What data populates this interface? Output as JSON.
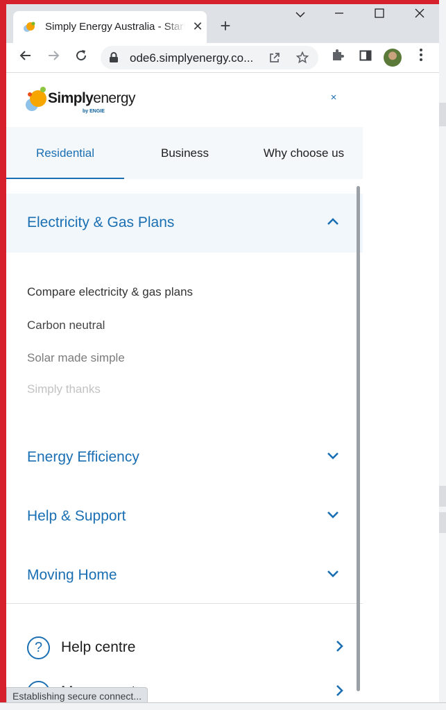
{
  "browser": {
    "tab_title": "Simply Energy Australia - Start",
    "new_tab": "+",
    "url": "ode6.simplyenergy.co...",
    "status": "Establishing secure connect..."
  },
  "site": {
    "brand_simply": "Simply",
    "brand_energy": "energy",
    "brand_by": "by ENGIE",
    "close": "×"
  },
  "nav_tabs": [
    "Residential",
    "Business",
    "Why choose us"
  ],
  "sections": {
    "open_title": "Electricity & Gas Plans",
    "sub_items": [
      {
        "label": "Compare electricity & gas plans",
        "color": "#333333"
      },
      {
        "label": "Carbon neutral",
        "color": "#444444"
      },
      {
        "label": "Solar made simple",
        "color": "#7b7b7b"
      },
      {
        "label": "Simply thanks",
        "color": "#c2c2c2"
      }
    ],
    "collapsed": [
      "Energy Efficiency",
      "Help & Support",
      "Moving Home"
    ]
  },
  "footer": {
    "help_centre": "Help centre",
    "help_icon": "?",
    "my_account": "My account"
  },
  "colors": {
    "accent": "#1a6fb3",
    "desktop_red": "#d6202c"
  }
}
